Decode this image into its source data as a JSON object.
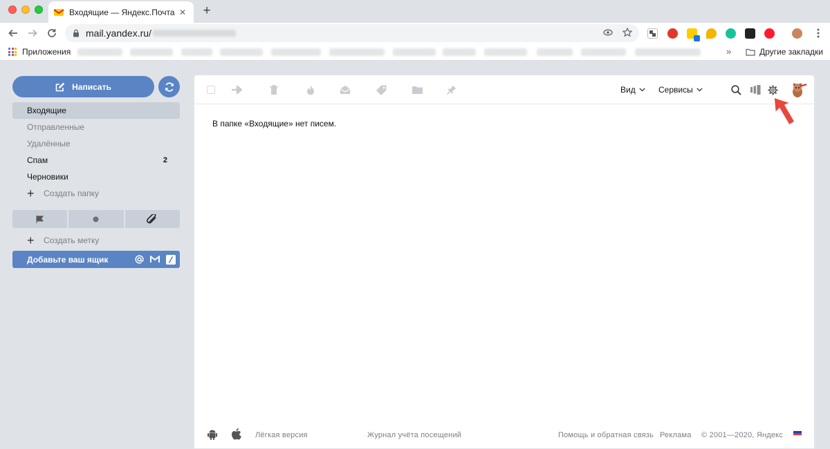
{
  "browser": {
    "tab_title": "Входящие — Яндекс.Почта",
    "tab_close": "✕",
    "new_tab": "+",
    "url": "mail.yandex.ru/",
    "bookmarks": {
      "apps_label": "Приложения",
      "more": "»",
      "other_label": "Другие закладки"
    }
  },
  "sidebar": {
    "compose_label": "Написать",
    "folders": [
      {
        "label": "Входящие",
        "count": ""
      },
      {
        "label": "Отправленные",
        "count": ""
      },
      {
        "label": "Удалённые",
        "count": ""
      },
      {
        "label": "Спам",
        "count": "2"
      },
      {
        "label": "Черновики",
        "count": ""
      }
    ],
    "create_folder": "Создать папку",
    "create_label": "Создать метку",
    "add_mailbox": "Добавьте ваш ящик"
  },
  "main": {
    "view_label": "Вид",
    "services_label": "Сервисы",
    "empty_message": "В папке «Входящие» нет писем."
  },
  "footer": {
    "light_version": "Лёгкая версия",
    "visits_log": "Журнал учёта посещений",
    "help": "Помощь и обратная связь",
    "ads": "Реклама",
    "copyright": "© 2001—2020, Яндекс"
  },
  "colors": {
    "accent": "#5b84c4",
    "active_folder": "#c8cfd9",
    "page_bg": "#dfe3e8",
    "arrow_annotation": "#e8473e"
  }
}
